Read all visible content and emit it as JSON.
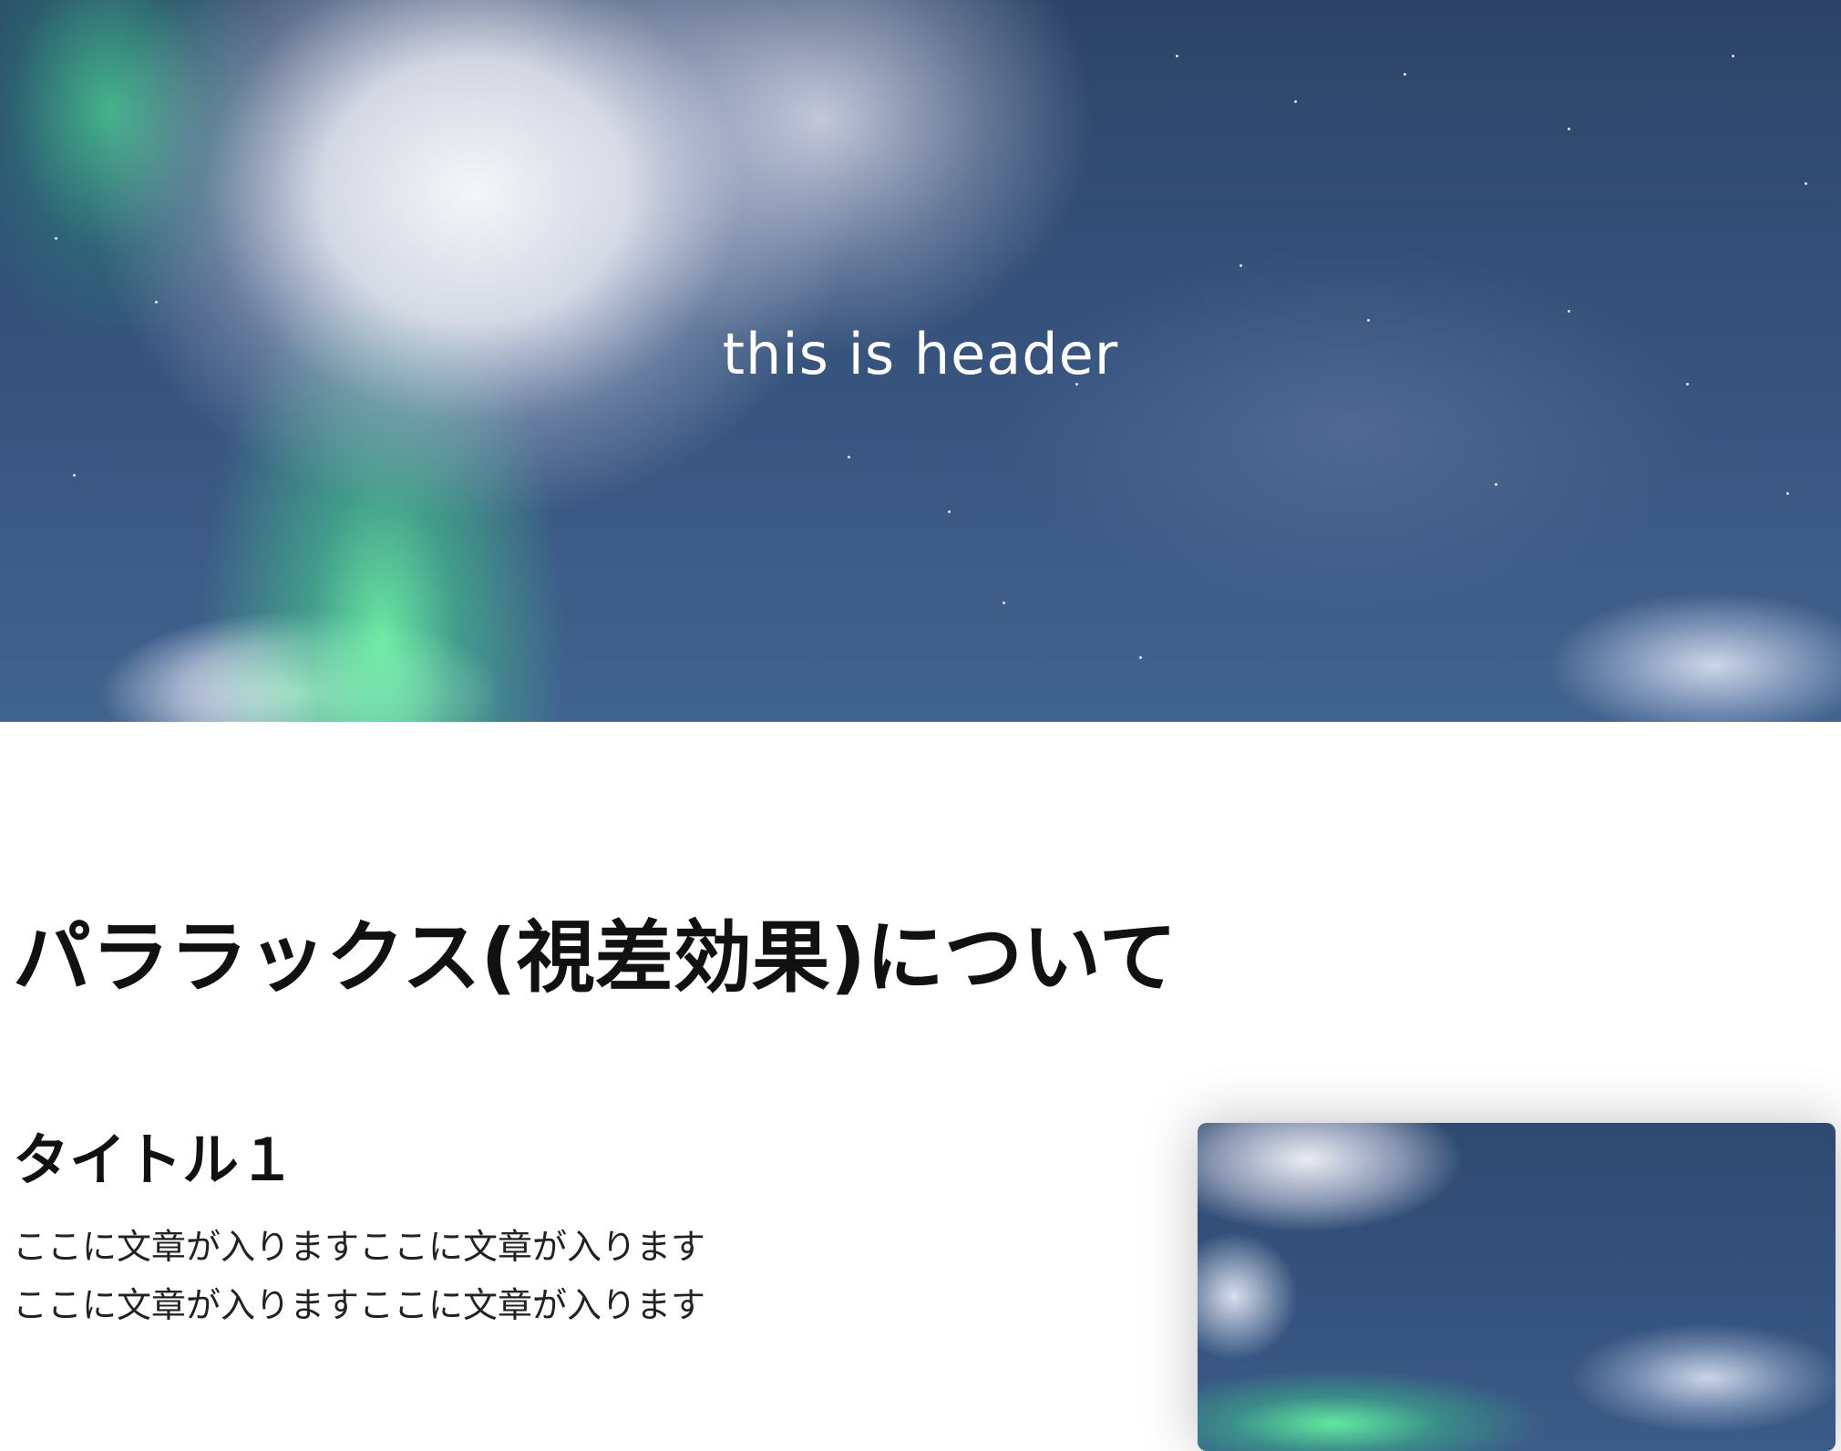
{
  "header": {
    "title": "this is header"
  },
  "main": {
    "heading": "パララックス(視差効果)について",
    "section": {
      "title": "タイトル１",
      "lines": [
        "ここに文章が入りますここに文章が入ります",
        "ここに文章が入りますここに文章が入ります"
      ]
    }
  }
}
